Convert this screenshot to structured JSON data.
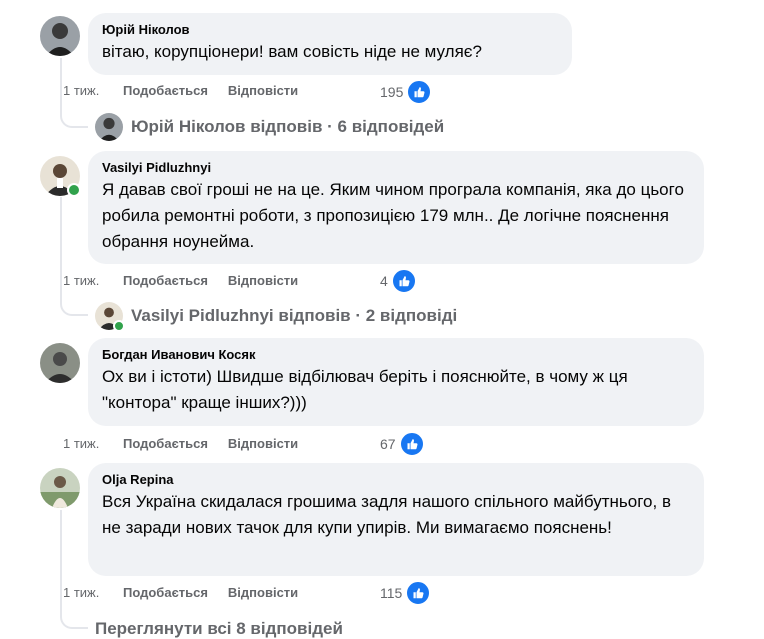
{
  "comments": [
    {
      "author": "Юрій Ніколов",
      "text": "вітаю, корупціонери! вам совість ніде не муляє?",
      "time": "1 тиж.",
      "like_label": "Подобається",
      "reply_label": "Відповісти",
      "reactions": "195",
      "replies": "Юрій Ніколов відповів · 6 відповідей"
    },
    {
      "author": "Vasilyi Pidluzhnyi",
      "text": "Я давав свої гроші не на це. Яким чином програла компанія, яка до цього робила ремонтні роботи, з пропозицією 179 млн.. Де логічне пояснення обрання ноунейма.",
      "time": "1 тиж.",
      "like_label": "Подобається",
      "reply_label": "Відповісти",
      "reactions": "4",
      "replies": "Vasilyi Pidluzhnyi відповів · 2 відповіді"
    },
    {
      "author": "Богдан Иванович Косяк",
      "text": "Ох ви і істоти) Швидше відбілювач беріть і пояснюйте, в чому ж ця \"контора\" краще інших?)))",
      "time": "1 тиж.",
      "like_label": "Подобається",
      "reply_label": "Відповісти",
      "reactions": "67"
    },
    {
      "author": "Olja Repina",
      "text": "Вся Україна скидалася грошима задля нашого спільного майбутнього, в не заради нових тачок для купи упирів. Ми вимагаємо пояснень!",
      "time": "1 тиж.",
      "like_label": "Подобається",
      "reply_label": "Відповісти",
      "reactions": "115"
    }
  ],
  "view_all_replies": "Переглянути всі 8 відповідей",
  "colors": {
    "bubble": "#f0f2f5",
    "secondary_text": "#65676b",
    "like_blue": "#1877f2",
    "online_green": "#31a24c"
  },
  "icons": {
    "like": "thumbs-up-icon",
    "online": "online-status-dot"
  }
}
